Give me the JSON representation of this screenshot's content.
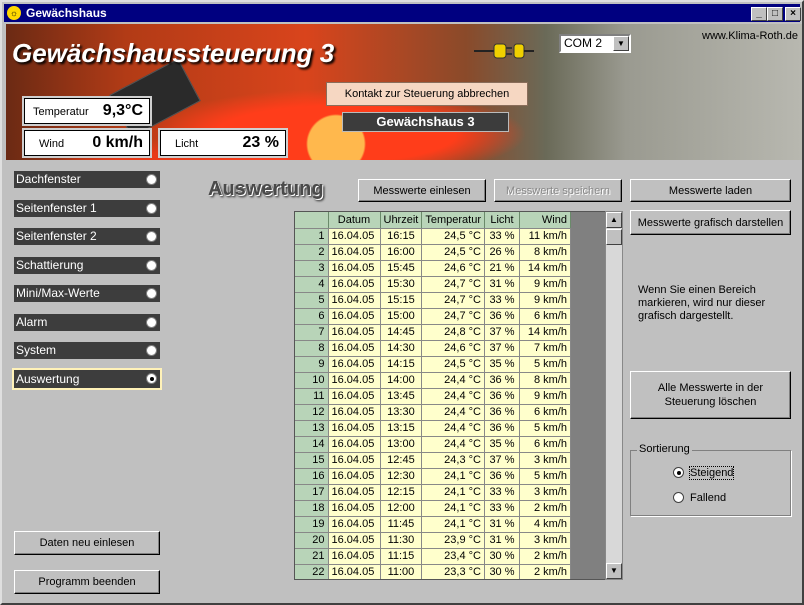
{
  "window": {
    "title": "Gewächshaus",
    "minimize": "_",
    "maximize": "□",
    "close": "×"
  },
  "header": {
    "title": "Gewächshaussteuerung 3",
    "website": "www.Klima-Roth.de",
    "com_port": "COM 2",
    "disconnect_label": "Kontakt zur Steuerung abbrechen",
    "status_label": "Gewächshaus 3",
    "temperature": {
      "label": "Temperatur",
      "value": "9,3°C"
    },
    "wind": {
      "label": "Wind",
      "value": "0 km/h"
    },
    "light": {
      "label": "Licht",
      "value": "23 %"
    }
  },
  "nav": {
    "items": [
      {
        "label": "Dachfenster"
      },
      {
        "label": "Seitenfenster 1"
      },
      {
        "label": "Seitenfenster 2"
      },
      {
        "label": "Schattierung"
      },
      {
        "label": "Mini/Max-Werte"
      },
      {
        "label": "Alarm"
      },
      {
        "label": "System"
      },
      {
        "label": "Auswertung"
      }
    ],
    "active": "Auswertung",
    "reload_label": "Daten neu einlesen",
    "exit_label": "Programm beenden"
  },
  "main": {
    "section_title": "Auswertung",
    "read_label": "Messwerte einlesen",
    "save_label": "Messwerte speichern",
    "load_label": "Messwerte laden",
    "graph_label": "Messwerte grafisch darstellen",
    "info": "Wenn Sie einen Bereich markieren, wird nur dieser grafisch dargestellt.",
    "delete_label": "Alle Messwerte in der Steuerung löschen",
    "sort": {
      "legend": "Sortierung",
      "asc": "Steigend",
      "desc": "Fallend",
      "selected": "Steigend"
    }
  },
  "table": {
    "columns": [
      "",
      "Datum",
      "Uhrzeit",
      "Temperatur",
      "Licht",
      "Wind"
    ],
    "rows": [
      [
        "1",
        "16.04.05",
        "16:15",
        "24,5 °C",
        "33 %",
        "11 km/h"
      ],
      [
        "2",
        "16.04.05",
        "16:00",
        "24,5 °C",
        "26 %",
        "8 km/h"
      ],
      [
        "3",
        "16.04.05",
        "15:45",
        "24,6 °C",
        "21 %",
        "14 km/h"
      ],
      [
        "4",
        "16.04.05",
        "15:30",
        "24,7 °C",
        "31 %",
        "9 km/h"
      ],
      [
        "5",
        "16.04.05",
        "15:15",
        "24,7 °C",
        "33 %",
        "9 km/h"
      ],
      [
        "6",
        "16.04.05",
        "15:00",
        "24,7 °C",
        "36 %",
        "6 km/h"
      ],
      [
        "7",
        "16.04.05",
        "14:45",
        "24,8 °C",
        "37 %",
        "14 km/h"
      ],
      [
        "8",
        "16.04.05",
        "14:30",
        "24,6 °C",
        "37 %",
        "7 km/h"
      ],
      [
        "9",
        "16.04.05",
        "14:15",
        "24,5 °C",
        "35 %",
        "5 km/h"
      ],
      [
        "10",
        "16.04.05",
        "14:00",
        "24,4 °C",
        "36 %",
        "8 km/h"
      ],
      [
        "11",
        "16.04.05",
        "13:45",
        "24,4 °C",
        "36 %",
        "9 km/h"
      ],
      [
        "12",
        "16.04.05",
        "13:30",
        "24,4 °C",
        "36 %",
        "6 km/h"
      ],
      [
        "13",
        "16.04.05",
        "13:15",
        "24,4 °C",
        "36 %",
        "5 km/h"
      ],
      [
        "14",
        "16.04.05",
        "13:00",
        "24,4 °C",
        "35 %",
        "6 km/h"
      ],
      [
        "15",
        "16.04.05",
        "12:45",
        "24,3 °C",
        "37 %",
        "3 km/h"
      ],
      [
        "16",
        "16.04.05",
        "12:30",
        "24,1 °C",
        "36 %",
        "5 km/h"
      ],
      [
        "17",
        "16.04.05",
        "12:15",
        "24,1 °C",
        "33 %",
        "3 km/h"
      ],
      [
        "18",
        "16.04.05",
        "12:00",
        "24,1 °C",
        "33 %",
        "2 km/h"
      ],
      [
        "19",
        "16.04.05",
        "11:45",
        "24,1 °C",
        "31 %",
        "4 km/h"
      ],
      [
        "20",
        "16.04.05",
        "11:30",
        "23,9 °C",
        "31 %",
        "3 km/h"
      ],
      [
        "21",
        "16.04.05",
        "11:15",
        "23,4 °C",
        "30 %",
        "2 km/h"
      ],
      [
        "22",
        "16.04.05",
        "11:00",
        "23,3 °C",
        "30 %",
        "2 km/h"
      ]
    ]
  },
  "icons": {
    "app": "greenhouse-sun-icon",
    "plug": "plug-icon",
    "dropdown": "chevron-down-icon",
    "scroll_up": "arrow-up-icon",
    "scroll_down": "arrow-down-icon"
  }
}
